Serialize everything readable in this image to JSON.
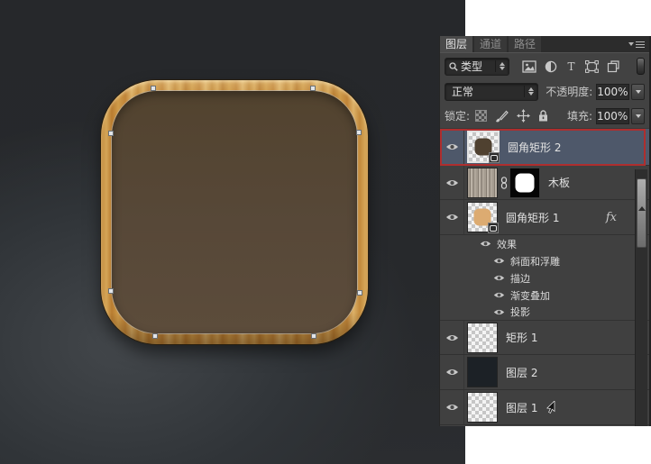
{
  "canvas": {
    "description": "dark document canvas with wooden rounded-square app icon and selected vector path"
  },
  "panel": {
    "tabs": [
      {
        "label": "图层"
      },
      {
        "label": "通道"
      },
      {
        "label": "路径"
      }
    ],
    "filter": {
      "type_label": "类型"
    },
    "blend": {
      "mode": "正常",
      "opacity_label": "不透明度:",
      "opacity_value": "100%"
    },
    "lock": {
      "label": "锁定:",
      "fill_label": "填充:",
      "fill_value": "100%"
    },
    "layers": [
      {
        "name": "圆角矩形 2"
      },
      {
        "name": "木板"
      },
      {
        "name": "圆角矩形 1",
        "fx": "fx"
      },
      {
        "name": "矩形 1"
      },
      {
        "name": "图层 2"
      },
      {
        "name": "图层 1"
      }
    ],
    "effects": {
      "header": "效果",
      "items": [
        {
          "label": "斜面和浮雕"
        },
        {
          "label": "描边"
        },
        {
          "label": "渐变叠加"
        },
        {
          "label": "投影"
        }
      ]
    }
  },
  "colors": {
    "selection_blue": "#4e586a",
    "annotation_red": "#ae2e2e",
    "wood": "#c28a3c",
    "icon_inner_brown": "#574838",
    "thumb_brown": "#4f4130",
    "thumb_tan": "#dcab71",
    "thumb_dark_layer": "#1c2126",
    "canvas_dark": "#26282b"
  }
}
